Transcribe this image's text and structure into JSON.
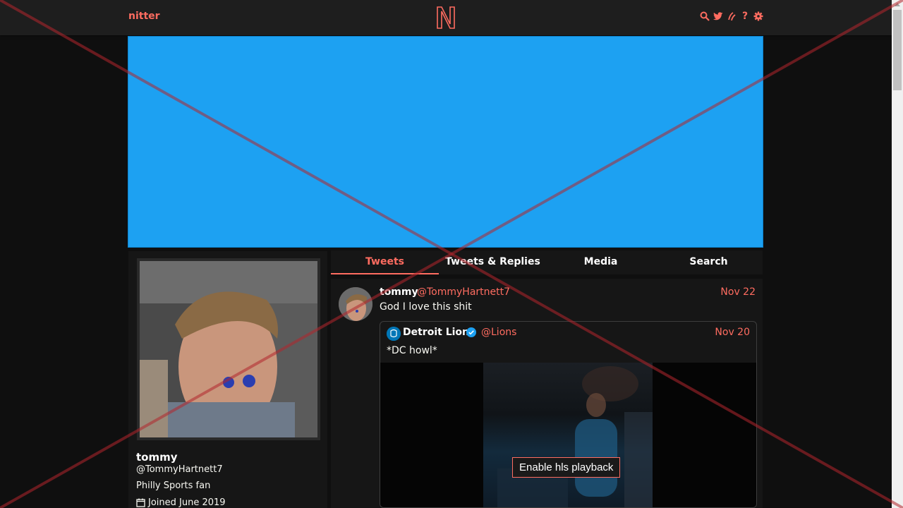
{
  "navbar": {
    "site_name": "nitter",
    "logo_letter": "N",
    "icons": [
      "search-icon",
      "twitter-icon",
      "rss-icon",
      "help-icon",
      "settings-icon"
    ],
    "help_label": "?"
  },
  "colors": {
    "accent": "#ff6c60",
    "banner": "#1da1f2",
    "background": "#0f0f0f",
    "panel": "#161616"
  },
  "profile": {
    "fullname": "tommy",
    "username": "@TommyHartnett7",
    "bio": "Philly Sports fan",
    "joined": "Joined June 2019"
  },
  "tabs": [
    {
      "label": "Tweets",
      "active": true
    },
    {
      "label": "Tweets & Replies",
      "active": false
    },
    {
      "label": "Media",
      "active": false
    },
    {
      "label": "Search",
      "active": false
    }
  ],
  "tweet": {
    "fullname": "tommy",
    "username": "@TommyHartnett7",
    "date": "Nov 22",
    "content": "God I love this shit",
    "quote": {
      "fullname": "Detroit Lions",
      "username": "@Lions",
      "date": "Nov 20",
      "text": "*DC howl*",
      "video_button": "Enable hls playback"
    }
  }
}
